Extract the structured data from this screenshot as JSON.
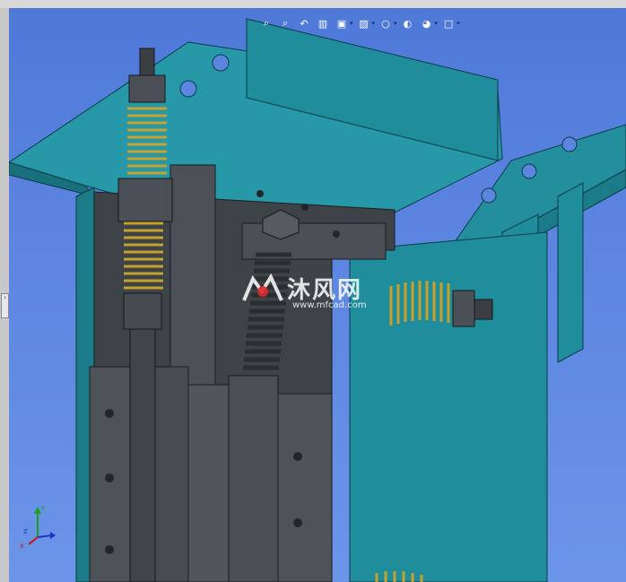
{
  "toolbar": {
    "items": [
      {
        "icon": "zoom-to-fit-icon"
      },
      {
        "icon": "zoom-to-area-icon"
      },
      {
        "icon": "previous-view-icon"
      },
      {
        "icon": "section-view-icon"
      },
      {
        "icon": "view-orientation-icon"
      },
      {
        "icon": "display-style-icon"
      },
      {
        "icon": "hide-show-items-icon"
      },
      {
        "icon": "edit-appearance-icon"
      },
      {
        "icon": "apply-scene-icon"
      },
      {
        "icon": "view-settings-icon"
      }
    ]
  },
  "watermark": {
    "brand": "沐风网",
    "url": "www.mfcad.com"
  },
  "triad": {
    "x_label": "X",
    "y_label": "Y",
    "z_label": "Z"
  },
  "colors": {
    "viewport_background": "#5b85e0",
    "sheet_metal": "#1f8d9c",
    "dark_metal": "#3e4348",
    "spring": "#c8a12a"
  }
}
